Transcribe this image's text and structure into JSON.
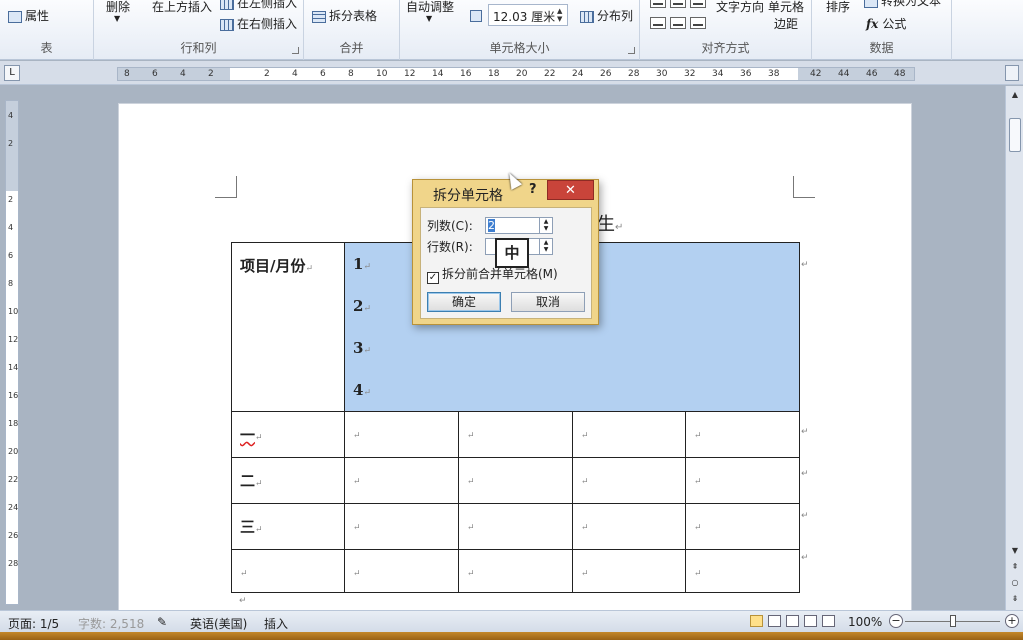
{
  "ribbon": {
    "table_group": {
      "properties": "属性",
      "label": "表"
    },
    "rows_cols_group": {
      "delete": "删除",
      "insert_above": "在上方插入",
      "insert_left": "在左侧插入",
      "insert_right": "在右侧插入",
      "label": "行和列"
    },
    "merge_group": {
      "split_table": "拆分表格",
      "label": "合并"
    },
    "cell_size_group": {
      "autofit": "自动调整",
      "height_value": "12.03 厘米",
      "distribute_cols": "分布列",
      "label": "单元格大小"
    },
    "alignment_group": {
      "text_direction": "文字方向",
      "cell_margins_1": "单元格",
      "cell_margins_2": "边距",
      "label": "对齐方式"
    },
    "data_group": {
      "sort": "排序",
      "convert_to_text": "转换为文本",
      "formula": "公式",
      "formula_icon": "fx",
      "label": "数据"
    }
  },
  "ruler": {
    "corner_glyph": "L",
    "ticks": [
      "8",
      "6",
      "4",
      "2",
      "2",
      "4",
      "6",
      "8",
      "10",
      "12",
      "14",
      "16",
      "18",
      "20",
      "22",
      "24",
      "26",
      "28",
      "30",
      "32",
      "34",
      "36",
      "38",
      "42",
      "44",
      "46",
      "48"
    ],
    "vticks": [
      "4",
      "2",
      "2",
      "4",
      "6",
      "8",
      "10",
      "12",
      "14",
      "16",
      "18",
      "20",
      "22",
      "24",
      "26",
      "28"
    ]
  },
  "document": {
    "title_fragment": "生",
    "header_cell": "项目/月份",
    "merged_cell_lines": [
      "1",
      "2",
      "3",
      "4"
    ],
    "row_labels": [
      "一",
      "二",
      "三",
      ""
    ],
    "para_mark": "↵"
  },
  "dialog": {
    "title": "拆分单元格",
    "help": "?",
    "close": "✕",
    "columns_label": "列数(C):",
    "columns_value": "2",
    "rows_label": "行数(R):",
    "rows_value": "",
    "ime_indicator": "中",
    "merge_checkbox_label": "拆分前合并单元格(M)",
    "merge_checked": true,
    "check_glyph": "✓",
    "ok": "确定",
    "cancel": "取消"
  },
  "status_bar": {
    "page": "页面: 1/5",
    "word_count": "字数: 2,518",
    "language": "英语(美国)",
    "mode": "插入",
    "zoom": "100%",
    "zoom_minus": "−",
    "zoom_plus": "+"
  },
  "colors": {
    "selection": "#b3d0f1",
    "dialog_frame": "#f0d58a",
    "close_button": "#c9443a"
  }
}
